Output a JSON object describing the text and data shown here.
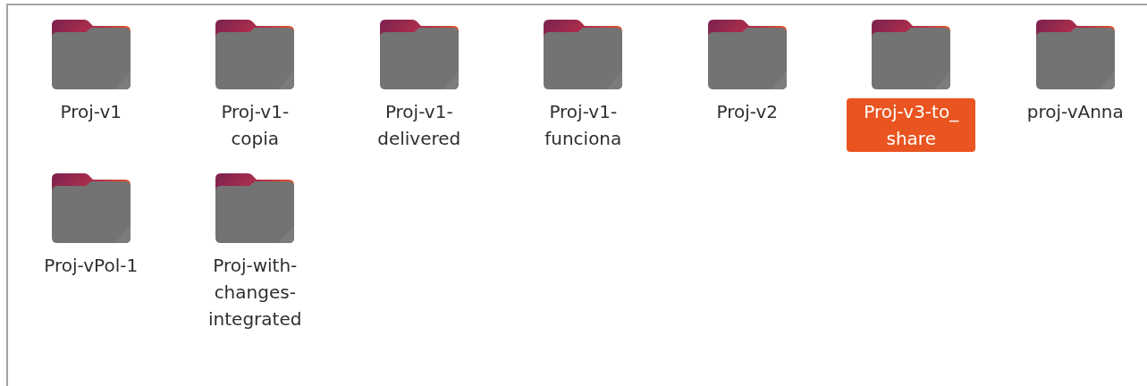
{
  "folders": [
    {
      "name": "Proj-v1",
      "selected": false
    },
    {
      "name": "Proj-v1-copia",
      "selected": false
    },
    {
      "name": "Proj-v1-delivered",
      "selected": false
    },
    {
      "name": "Proj-v1-funciona",
      "selected": false
    },
    {
      "name": "Proj-v2",
      "selected": false
    },
    {
      "name": "Proj-v3-to_share",
      "selected": true
    },
    {
      "name": "proj-vAnna",
      "selected": false
    },
    {
      "name": "Proj-vPol-1",
      "selected": false
    },
    {
      "name": "Proj-with-changes-integrated",
      "selected": false
    }
  ]
}
